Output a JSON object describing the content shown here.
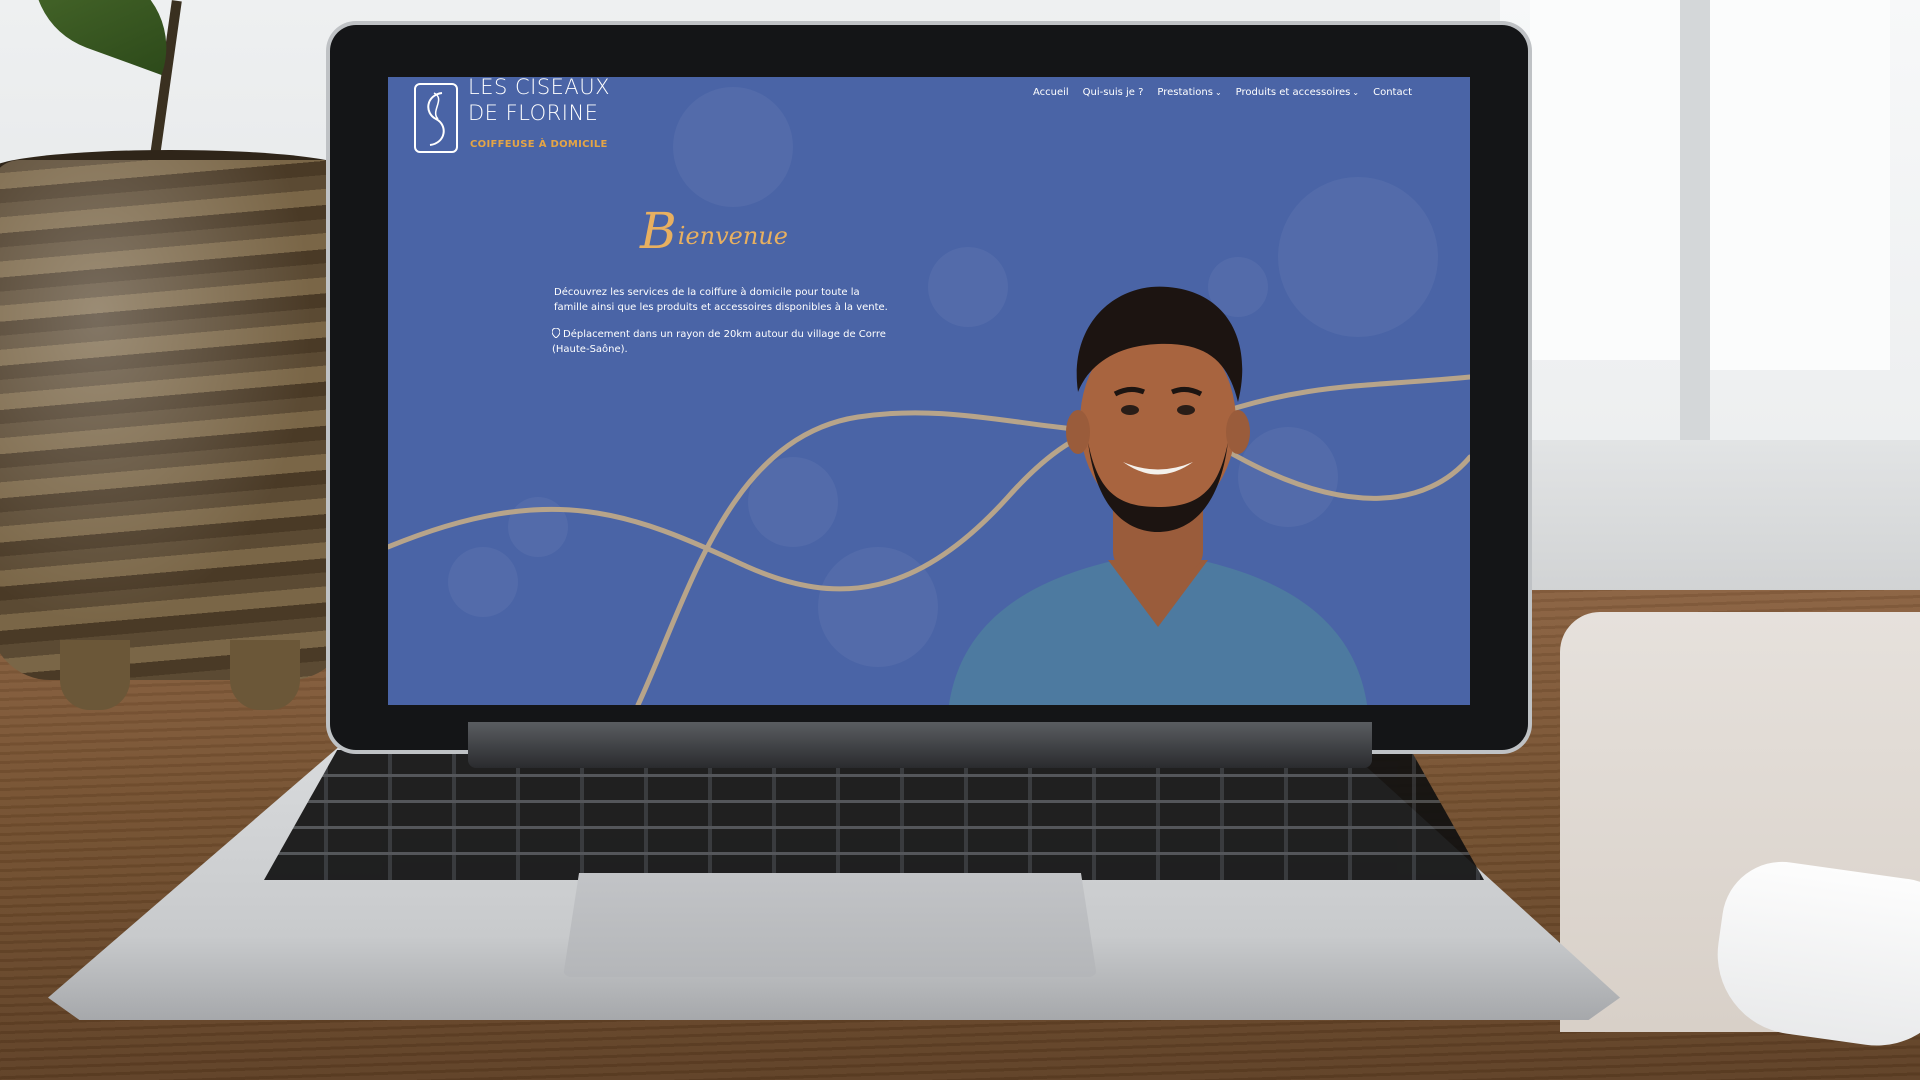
{
  "site": {
    "logo": {
      "line1": "LES CISEAUX",
      "line2": "DE FLORINE",
      "tagline": "COIFFEUSE À DOMICILE"
    },
    "nav": [
      {
        "label": "Accueil",
        "has_dropdown": false
      },
      {
        "label": "Qui-suis je ?",
        "has_dropdown": false
      },
      {
        "label": "Prestations",
        "has_dropdown": true
      },
      {
        "label": "Produits et accessoires",
        "has_dropdown": true
      },
      {
        "label": "Contact",
        "has_dropdown": false
      }
    ],
    "hero": {
      "headline_initial": "B",
      "headline_rest": "ienvenue",
      "intro": "Découvrez les services de la coiffure à domicile pour toute la famille ainsi que les produits et accessoires disponibles à la vente.",
      "area_icon": "map-pin-icon",
      "area": "Déplacement dans un rayon de 20km autour du village de Corre (Haute-Saône)."
    },
    "colors": {
      "background": "#4a64a6",
      "accent": "#e8b060",
      "wave": "#b7a48a",
      "text": "#ffffff"
    }
  }
}
